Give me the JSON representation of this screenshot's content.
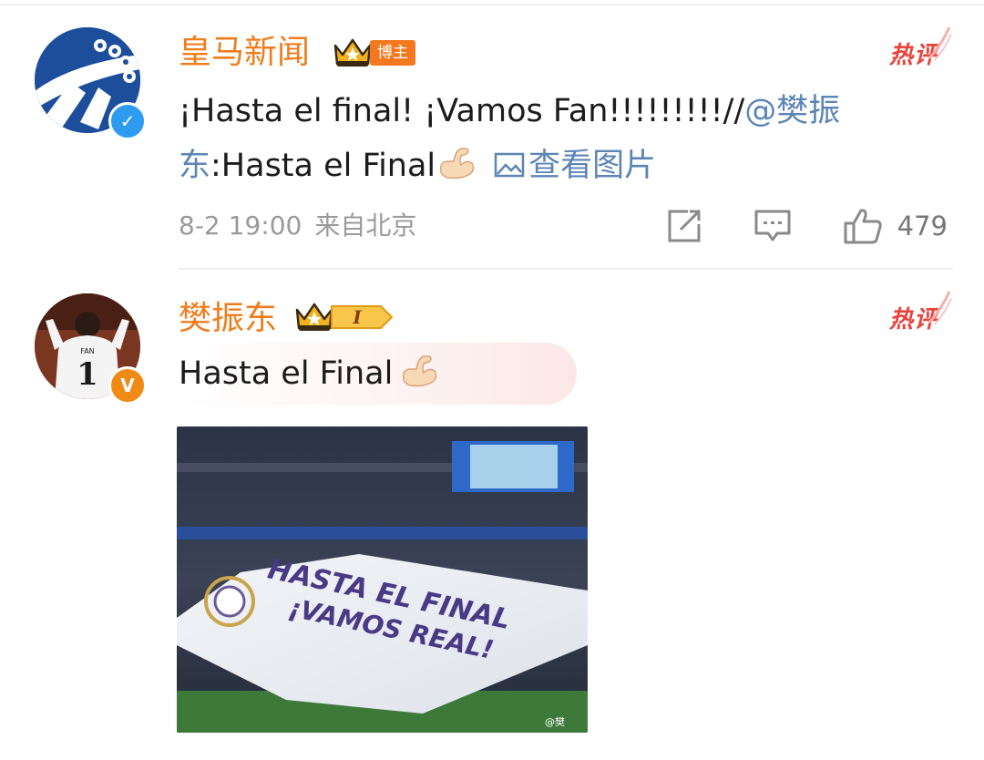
{
  "comments": [
    {
      "username": "皇马新闻",
      "badge_label": "博主",
      "hot_label": "热评",
      "text_main": "¡Hasta el final! ¡Vamos Fan!!!!!!!!!//",
      "mention": "@樊振东",
      "mention_line1": "@樊振",
      "mention_line2": "东",
      "quoted_text": ":Hasta el Final",
      "view_image_label": "查看图片",
      "timestamp": "8-2 19:00",
      "source": "来自北京",
      "like_count": "479",
      "icons": {
        "crown": "crown-icon",
        "verify": "verified-blue-icon",
        "repost": "repost-icon",
        "comment": "comment-icon",
        "like": "thumbs-up-icon",
        "image": "image-icon",
        "emoji": "flexed-biceps-icon"
      }
    },
    {
      "username": "樊振东",
      "level_label": "I",
      "hot_label": "热评",
      "text": "Hasta el Final",
      "icons": {
        "crown": "crown-icon",
        "verify": "verified-orange-icon",
        "emoji": "flexed-biceps-icon"
      },
      "photo": {
        "banner_line1": "HASTA EL FINAL",
        "banner_line2": "¡VAMOS REAL!",
        "watermark": "@樊",
        "description_icon": "stadium-banner-photo"
      }
    }
  ],
  "colors": {
    "username": "#f07d1c",
    "link": "#5b85b4",
    "hot": "#e8423b",
    "meta": "#9a9a9a",
    "verify_blue": "#2d9cf0",
    "verify_orange": "#f08a14"
  }
}
